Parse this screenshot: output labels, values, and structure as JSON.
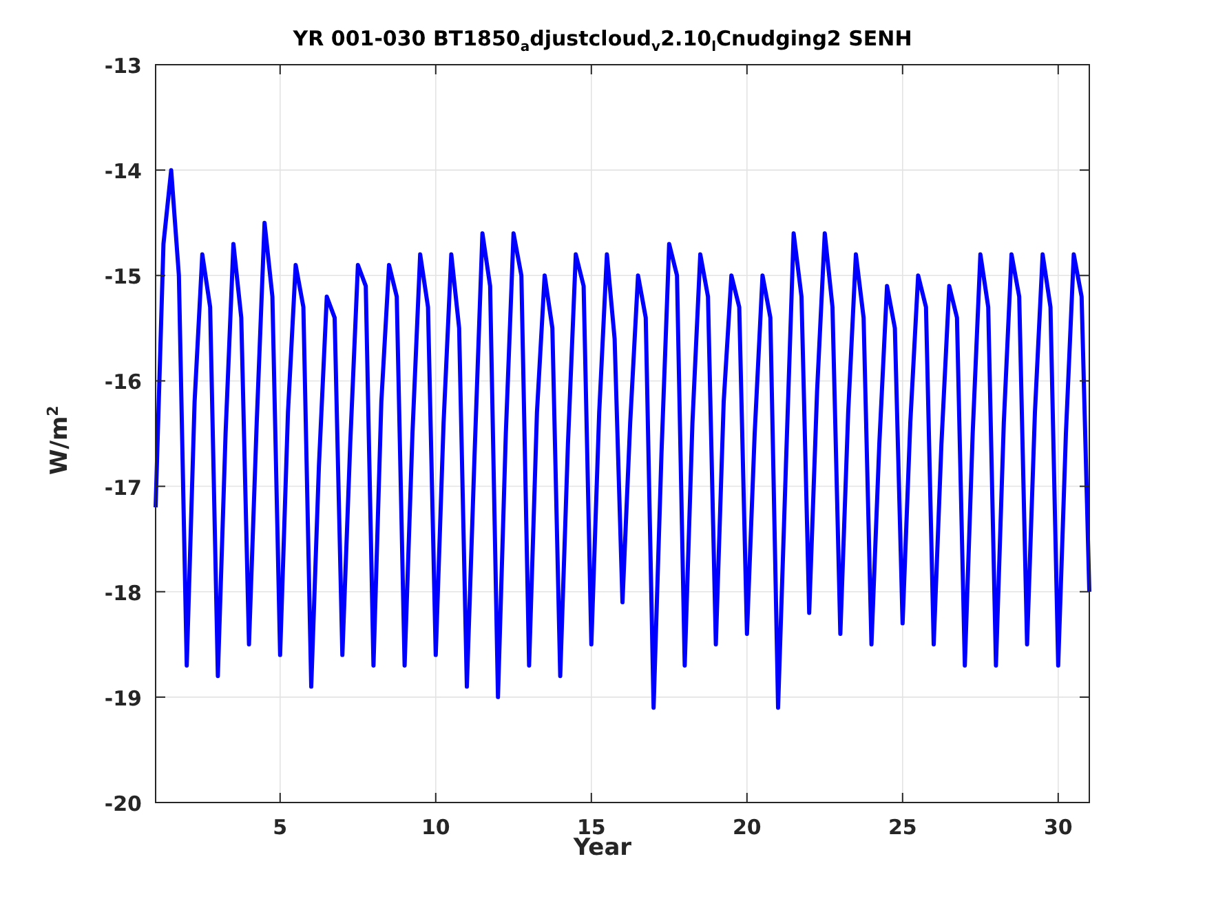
{
  "figure": {
    "chart_data": {
      "type": "line",
      "title": "YR 001-030 BT1850$_{a}$djustcloud$_{v}$2.10$_{l}$Cnudging2 SENH",
      "xlabel": "Year",
      "ylabel": "W/m$^{2}$",
      "xlim": [
        1,
        31
      ],
      "ylim": [
        -20,
        -13
      ],
      "xticks": [
        5,
        10,
        15,
        20,
        25,
        30
      ],
      "yticks": [
        -20,
        -19,
        -18,
        -17,
        -16,
        -15,
        -14,
        -13
      ],
      "x": [
        1,
        1.25,
        1.5,
        1.75,
        2,
        2.25,
        2.5,
        2.75,
        3,
        3.25,
        3.5,
        3.75,
        4,
        4.25,
        4.5,
        4.75,
        5,
        5.25,
        5.5,
        5.75,
        6,
        6.25,
        6.5,
        6.75,
        7,
        7.25,
        7.5,
        7.75,
        8,
        8.25,
        8.5,
        8.75,
        9,
        9.25,
        9.5,
        9.75,
        10,
        10.25,
        10.5,
        10.75,
        11,
        11.25,
        11.5,
        11.75,
        12,
        12.25,
        12.5,
        12.75,
        13,
        13.25,
        13.5,
        13.75,
        14,
        14.25,
        14.5,
        14.75,
        15,
        15.25,
        15.5,
        15.75,
        16,
        16.25,
        16.5,
        16.75,
        17,
        17.25,
        17.5,
        17.75,
        18,
        18.25,
        18.5,
        18.75,
        19,
        19.25,
        19.5,
        19.75,
        20,
        20.25,
        20.5,
        20.75,
        21,
        21.25,
        21.5,
        21.75,
        22,
        22.25,
        22.5,
        22.75,
        23,
        23.25,
        23.5,
        23.75,
        24,
        24.25,
        24.5,
        24.75,
        25,
        25.25,
        25.5,
        25.75,
        26,
        26.25,
        26.5,
        26.75,
        27,
        27.25,
        27.5,
        27.75,
        28,
        28.25,
        28.5,
        28.75,
        29,
        29.25,
        29.5,
        29.75,
        30,
        30.25,
        30.5,
        30.75,
        31
      ],
      "grid": true,
      "series": [
        {
          "color": "#0000ff",
          "values": [
            -17.2,
            -14.7,
            -14.0,
            -15.0,
            -18.7,
            -16.2,
            -14.8,
            -15.3,
            -18.8,
            -16.5,
            -14.7,
            -15.4,
            -18.5,
            -16.4,
            -14.5,
            -15.2,
            -18.6,
            -16.3,
            -14.9,
            -15.3,
            -18.9,
            -16.8,
            -15.2,
            -15.4,
            -18.6,
            -16.6,
            -14.9,
            -15.1,
            -18.7,
            -16.2,
            -14.9,
            -15.2,
            -18.7,
            -16.5,
            -14.8,
            -15.3,
            -18.6,
            -16.4,
            -14.8,
            -15.5,
            -18.9,
            -16.7,
            -14.6,
            -15.1,
            -19.0,
            -16.5,
            -14.6,
            -15.0,
            -18.7,
            -16.3,
            -15.0,
            -15.5,
            -18.8,
            -16.6,
            -14.8,
            -15.1,
            -18.5,
            -16.3,
            -14.8,
            -15.6,
            -18.1,
            -16.4,
            -15.0,
            -15.4,
            -19.1,
            -16.7,
            -14.7,
            -15.0,
            -18.7,
            -16.4,
            -14.8,
            -15.2,
            -18.5,
            -16.2,
            -15.0,
            -15.3,
            -18.4,
            -16.5,
            -15.0,
            -15.4,
            -19.1,
            -16.8,
            -14.6,
            -15.2,
            -18.2,
            -16.1,
            -14.6,
            -15.3,
            -18.4,
            -16.3,
            -14.8,
            -15.4,
            -18.5,
            -16.6,
            -15.1,
            -15.5,
            -18.3,
            -16.4,
            -15.0,
            -15.3,
            -18.5,
            -16.6,
            -15.1,
            -15.4,
            -18.7,
            -16.5,
            -14.8,
            -15.3,
            -18.7,
            -16.4,
            -14.8,
            -15.2,
            -18.5,
            -16.3,
            -14.8,
            -15.3,
            -18.7,
            -16.5,
            -14.8,
            -15.2,
            -18.0
          ]
        }
      ]
    }
  }
}
